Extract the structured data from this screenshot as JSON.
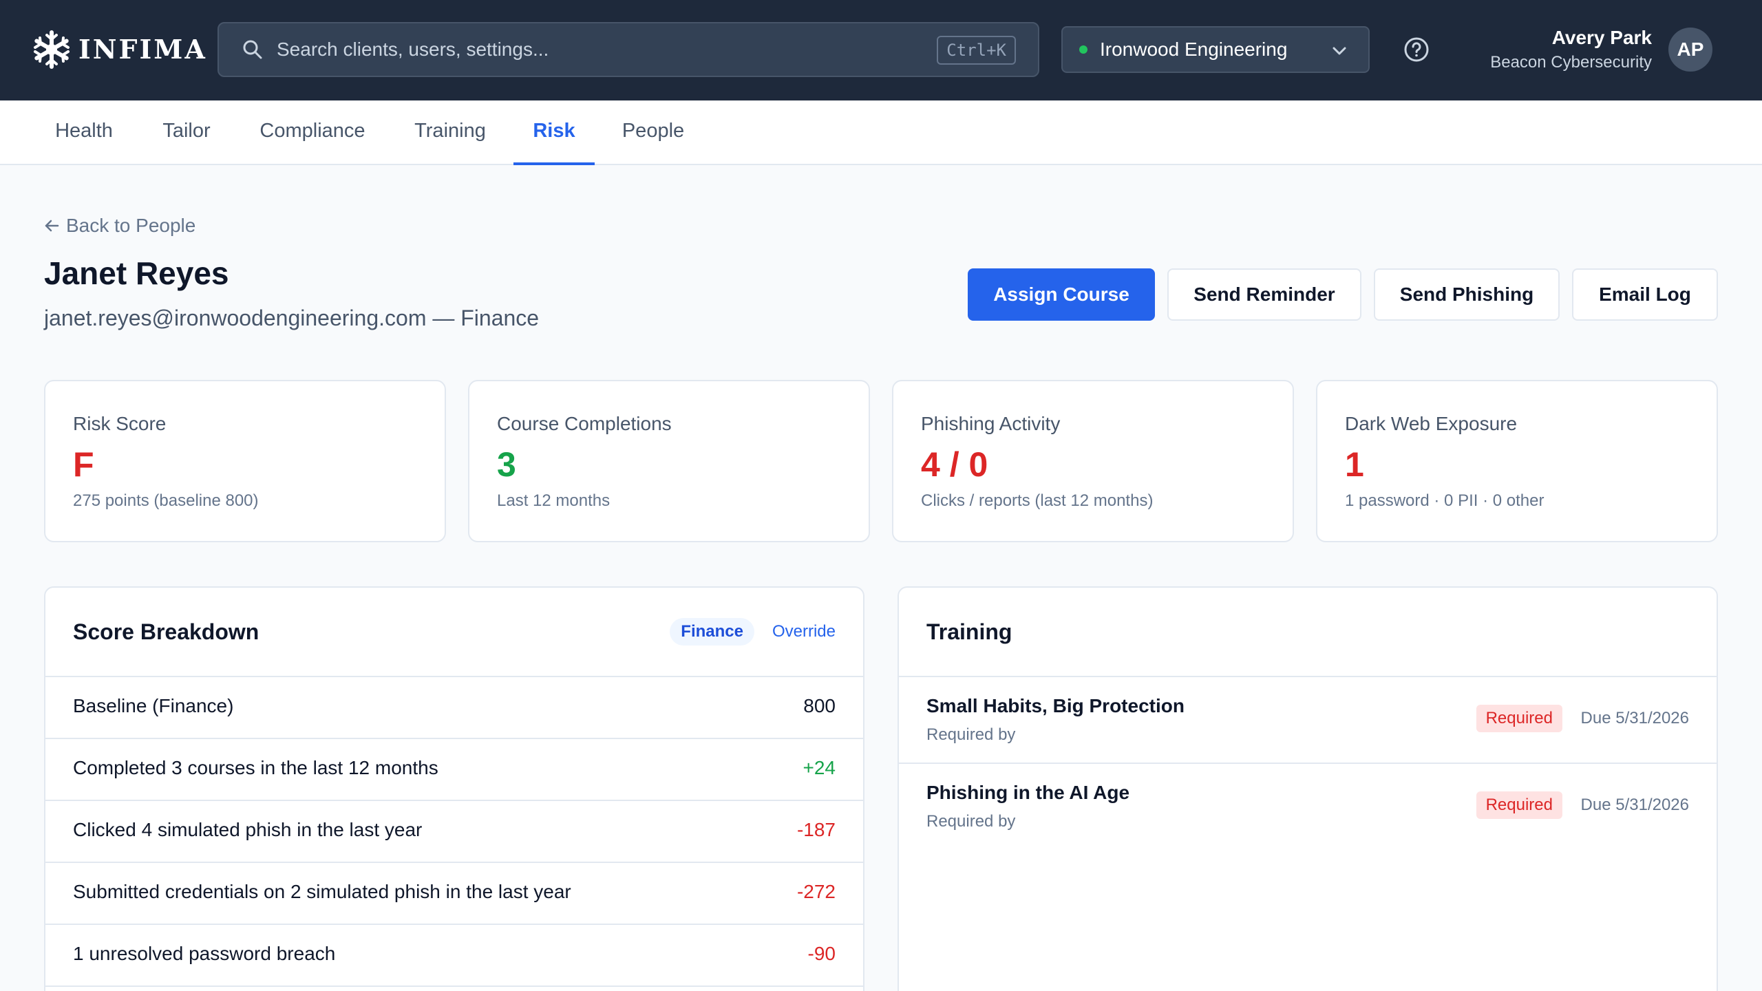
{
  "app": {
    "logo_text": "INFIMA",
    "search_placeholder": "Search clients, users, settings...",
    "search_shortcut": "Ctrl+K",
    "org_selector": "Ironwood Engineering",
    "user_name": "Avery Park",
    "user_org": "Beacon Cybersecurity",
    "user_initials": "AP"
  },
  "tabs": [
    "Health",
    "Tailor",
    "Compliance",
    "Training",
    "Risk",
    "People"
  ],
  "active_tab": "Risk",
  "page": {
    "back_label": "Back to People",
    "name": "Janet Reyes",
    "subtitle": "janet.reyes@ironwoodengineering.com — Finance"
  },
  "actions": {
    "assign": "Assign Course",
    "reminder": "Send Reminder",
    "phishing": "Send Phishing",
    "email_log": "Email Log"
  },
  "stats": [
    {
      "label": "Risk Score",
      "value": "F",
      "note": "275 points (baseline 800)",
      "color": "#dc2626"
    },
    {
      "label": "Course Completions",
      "value": "3",
      "note": "Last 12 months",
      "color": "#16a34a"
    },
    {
      "label": "Phishing Activity",
      "value": "4 / 0",
      "note": "Clicks / reports (last 12 months)",
      "color": "#dc2626"
    },
    {
      "label": "Dark Web Exposure",
      "value": "1",
      "note": "1 password · 0 PII · 0 other",
      "color": "#dc2626"
    }
  ],
  "breakdown": {
    "title": "Score Breakdown",
    "chip": "Finance",
    "override": "Override",
    "rows": [
      {
        "label": "Baseline (Finance)",
        "value": "800"
      },
      {
        "label": "Completed 3 courses in the last 12 months",
        "value": "+24"
      },
      {
        "label": "Clicked 4 simulated phish in the last year",
        "value": "-187"
      },
      {
        "label": "Submitted credentials on 2 simulated phish in the last year",
        "value": "-272"
      },
      {
        "label": "1 unresolved password breach",
        "value": "-90"
      }
    ]
  },
  "training": {
    "title": "Training",
    "items": [
      {
        "title": "Small Habits, Big Protection",
        "sub": "Required by",
        "badge": "Required",
        "due": "Due 5/31/2026"
      },
      {
        "title": "Phishing in the AI Age",
        "sub": "Required by",
        "badge": "Required",
        "due": "Due 5/31/2026"
      }
    ]
  },
  "colors": {
    "topbar": "#1e293b",
    "accent": "#2563eb",
    "negative": "#dc2626",
    "positive": "#16a34a"
  }
}
